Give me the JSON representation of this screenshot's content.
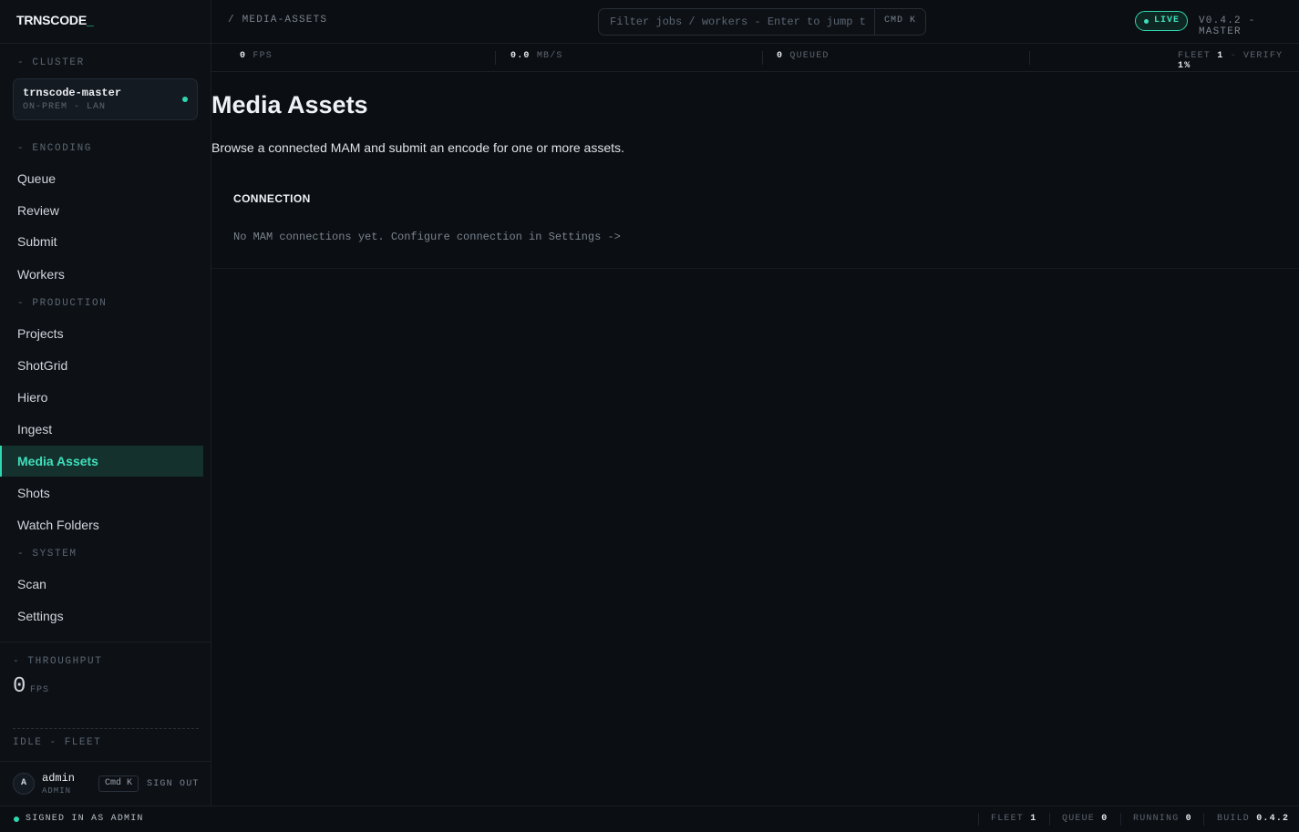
{
  "brand": {
    "name": "TRNSCODE",
    "cursor": "_"
  },
  "sidebar": {
    "cluster_label": "- CLUSTER",
    "cluster_name": "trnscode-master",
    "cluster_sub": "ON-PREM - LAN",
    "encoding_label": "- ENCODING",
    "production_label": "- PRODUCTION",
    "system_label": "- SYSTEM",
    "encoding_items": [
      "Queue",
      "Review",
      "Submit",
      "Workers"
    ],
    "production_items": [
      "Projects",
      "ShotGrid",
      "Hiero",
      "Ingest",
      "Media Assets",
      "Shots",
      "Watch Folders"
    ],
    "system_items": [
      "Scan",
      "Settings"
    ],
    "active_item": "Media Assets",
    "throughput_label": "- THROUGHPUT",
    "throughput_value": "0",
    "throughput_unit": "FPS",
    "idle_fleet": "IDLE - FLEET",
    "user": {
      "initial": "A",
      "name": "admin",
      "role": "ADMIN"
    },
    "shortcut": "Cmd K",
    "signout": "SIGN OUT"
  },
  "header": {
    "breadcrumb": "/ MEDIA-ASSETS",
    "search_placeholder": "Filter jobs / workers - Enter to jump t",
    "search_kbd": "CMD K",
    "live": "LIVE",
    "version": "V0.4.2 - MASTER"
  },
  "stats": {
    "fps_value": "0",
    "fps_label": "FPS",
    "mbs_value": "0.0",
    "mbs_label": "MB/S",
    "queued_value": "0",
    "queued_label": "QUEUED",
    "fleet_label": "FLEET",
    "fleet_value": "1",
    "sep": "-",
    "verify_label": "VERIFY",
    "verify_value": "1%"
  },
  "main": {
    "title": "Media Assets",
    "subtitle": "Browse a connected MAM and submit an encode for one or more assets.",
    "connection_heading": "CONNECTION",
    "connection_empty": "No MAM connections yet. Configure connection in Settings ->"
  },
  "footer": {
    "status": "SIGNED IN AS ADMIN",
    "fleet_label": "FLEET",
    "fleet_value": "1",
    "queue_label": "QUEUE",
    "queue_value": "0",
    "running_label": "RUNNING",
    "running_value": "0",
    "build_label": "BUILD",
    "build_value": "0.4.2"
  },
  "colors": {
    "accent": "#2fd6b0",
    "background": "#0b0e12",
    "sidebar": "#0d1116"
  }
}
